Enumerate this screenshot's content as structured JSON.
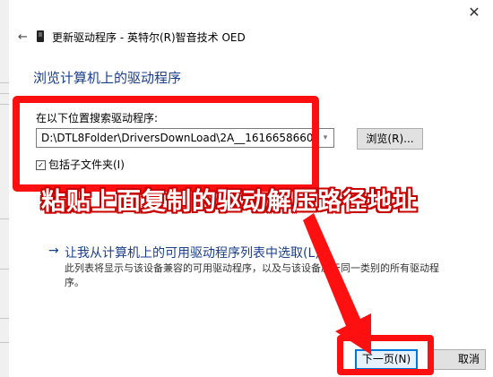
{
  "window": {
    "title": "更新驱动程序 - 英特尔(R)智音技术 OED",
    "close_symbol": "✕"
  },
  "nav": {
    "back_symbol": "←"
  },
  "page": {
    "heading": "浏览计算机上的驱动程序",
    "search_label": "在以下位置搜索驱动程序:",
    "path_value": "D:\\DTL8Folder\\DriversDownLoad\\2A__1616658660",
    "browse_label": "浏览(R)...",
    "include_subfolders_label": "包括子文件夹(I)",
    "include_subfolders_checked": true,
    "pick_link": "让我从计算机上的可用驱动程序列表中选取(L)",
    "pick_desc_line1": "此列表将显示与该设备兼容的可用驱动程序，以及与该设备属于同一类别的所有驱动程",
    "pick_desc_line2": "序。"
  },
  "annotation": {
    "text": "粘贴上面复制的驱动解压路径地址",
    "color": "#ff1010"
  },
  "footer": {
    "next_label": "下一页(N)",
    "cancel_label": "取消"
  },
  "icons": {
    "back": "back-arrow-icon",
    "device": "speaker-device-icon",
    "dropdown": "chevron-down-icon",
    "checkbox": "checkbox-checked-icon",
    "link_arrow": "arrow-right-icon"
  }
}
